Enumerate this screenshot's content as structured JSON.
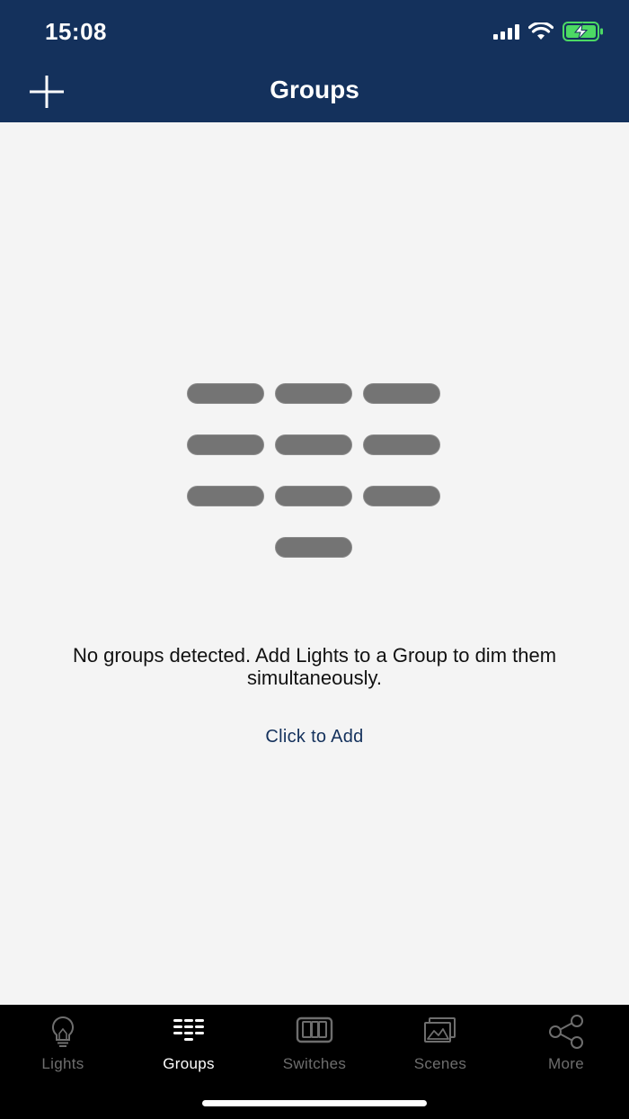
{
  "status_bar": {
    "time": "15:08"
  },
  "header": {
    "title": "Groups",
    "add_icon": "plus-icon"
  },
  "empty_state": {
    "icon": "groups-grid-icon",
    "message": "No groups detected. Add Lights to a Group to dim them simultaneously.",
    "action_label": "Click to Add"
  },
  "tabs": [
    {
      "label": "Lights",
      "icon": "lightbulb-icon",
      "active": false
    },
    {
      "label": "Groups",
      "icon": "groups-icon",
      "active": true
    },
    {
      "label": "Switches",
      "icon": "switches-icon",
      "active": false
    },
    {
      "label": "Scenes",
      "icon": "scenes-icon",
      "active": false
    },
    {
      "label": "More",
      "icon": "share-icon",
      "active": false
    }
  ],
  "colors": {
    "header_bg": "#14315c",
    "background": "#f4f4f4",
    "tabbar_bg": "#000000",
    "accent": "#14315c",
    "inactive_tab": "#6e6e6e",
    "battery_charging": "#4cd964"
  }
}
